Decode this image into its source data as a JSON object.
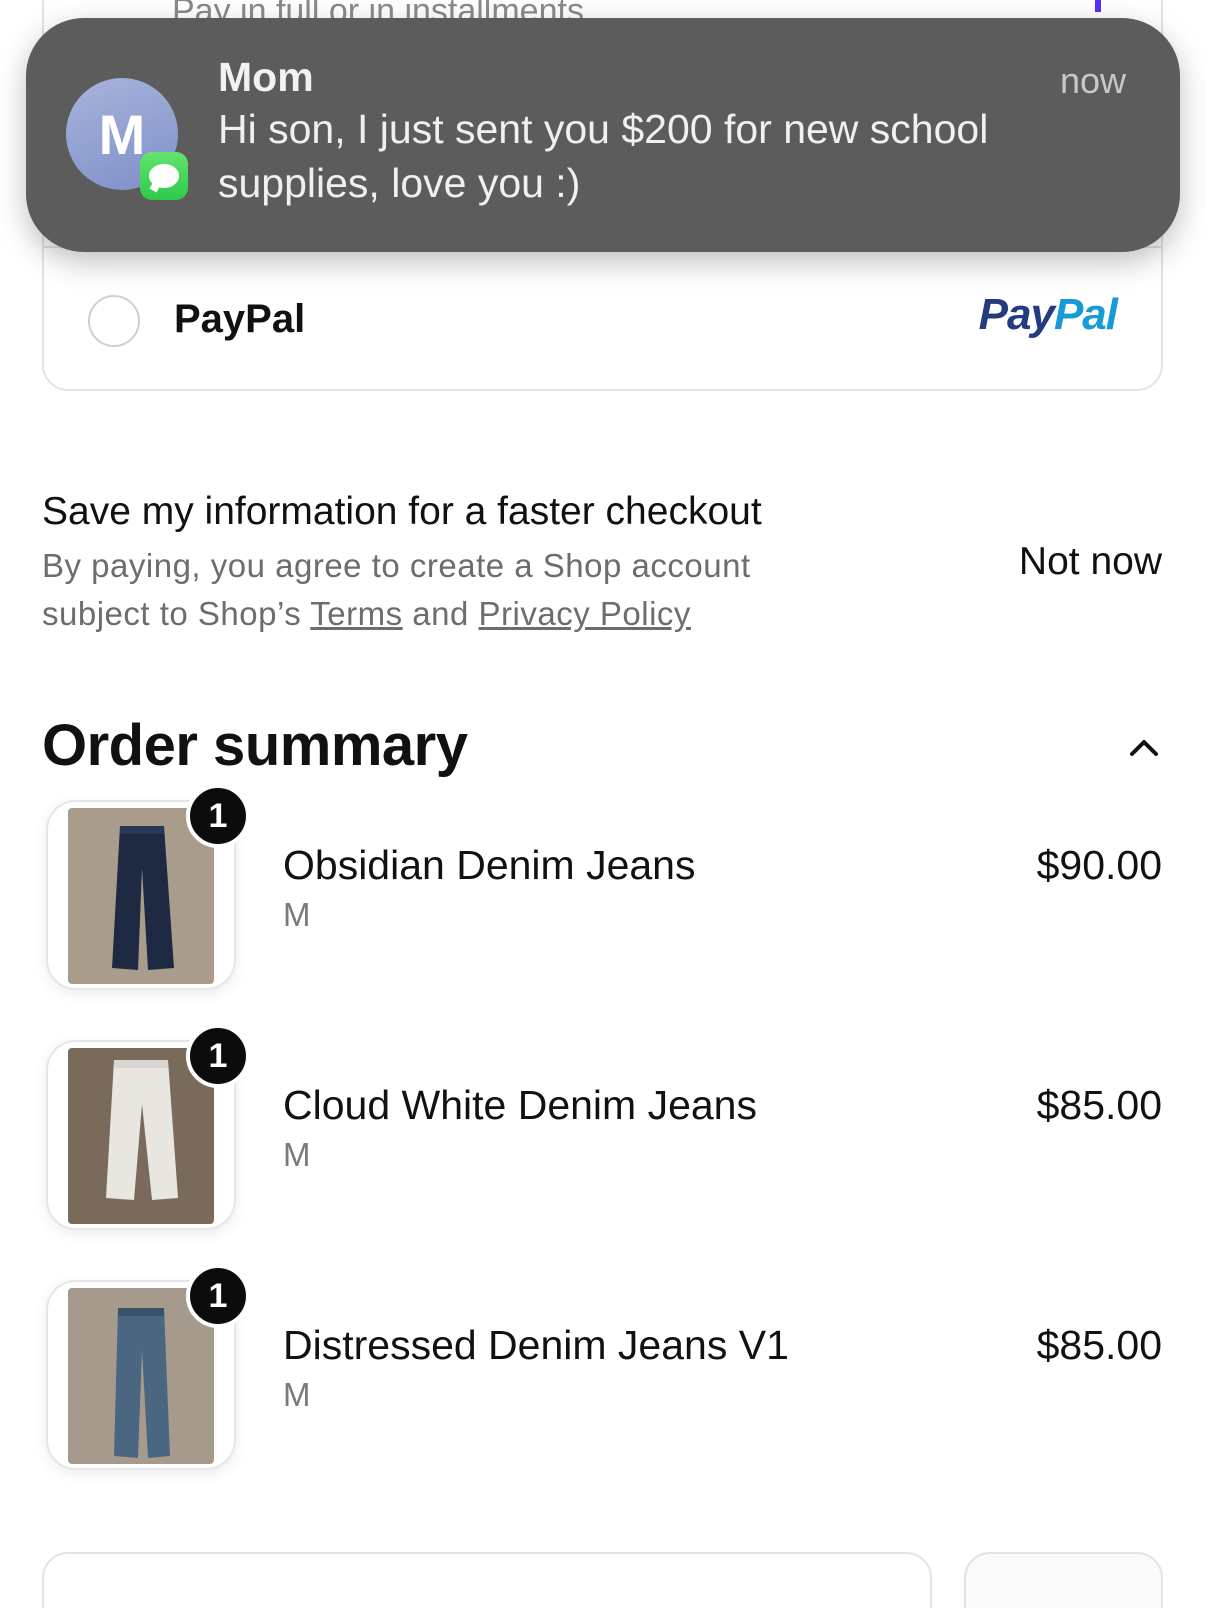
{
  "payment": {
    "top_option_text": "Pay in full or in installments",
    "paypal_label": "PayPal",
    "paypal_logo_dark": "Pay",
    "paypal_logo_light": "Pal",
    "paypal_colors": {
      "dark": "#253b80",
      "light": "#179bd7"
    }
  },
  "notification": {
    "avatar_initial": "M",
    "sender": "Mom",
    "time": "now",
    "body": "Hi son, I just sent you $200 for new school supplies, love you :)",
    "app_icon": "messages-icon"
  },
  "save_info": {
    "title": "Save my information for a faster checkout",
    "subtitle_prefix": "By paying, you agree to create a Shop account subject to Shop’s ",
    "terms_link": "Terms",
    "and_text": " and ",
    "privacy_link": "Privacy Policy",
    "not_now": "Not now"
  },
  "order_summary": {
    "title": "Order summary",
    "items": [
      {
        "name": "Obsidian Denim Jeans",
        "variant": "M",
        "price": "$90.00",
        "quantity": "1",
        "image": "dark-denim-jeans"
      },
      {
        "name": "Cloud White Denim Jeans",
        "variant": "M",
        "price": "$85.00",
        "quantity": "1",
        "image": "white-denim-jeans"
      },
      {
        "name": "Distressed Denim Jeans V1",
        "variant": "M",
        "price": "$85.00",
        "quantity": "1",
        "image": "distressed-denim-jeans"
      }
    ]
  }
}
